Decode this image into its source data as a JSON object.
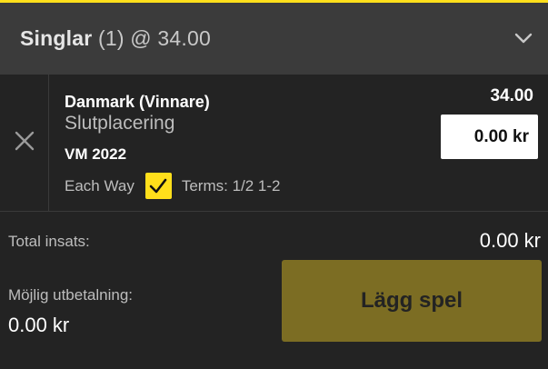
{
  "header": {
    "title": "Singlar",
    "count": "(1)",
    "odds_text": "@ 34.00",
    "chevron_icon": "chevron-down-icon"
  },
  "bet": {
    "remove_icon": "close-icon",
    "selection": "Danmark (Vinnare)",
    "market": "Slutplacering",
    "event": "VM 2022",
    "odds": "34.00",
    "stake_value": "0.00 kr",
    "each_way_label": "Each Way",
    "each_way_checked": true,
    "terms": "Terms: 1/2 1-2"
  },
  "footer": {
    "total_label": "Total insats:",
    "total_value": "0.00 kr",
    "payout_label": "Möjlig utbetalning:",
    "payout_value": "0.00 kr",
    "place_bet_label": "Lägg spel"
  },
  "colors": {
    "accent": "#ffdf1b",
    "header_bg": "#3b3b3b",
    "body_bg": "#232323",
    "button_disabled": "#7c6d23"
  }
}
